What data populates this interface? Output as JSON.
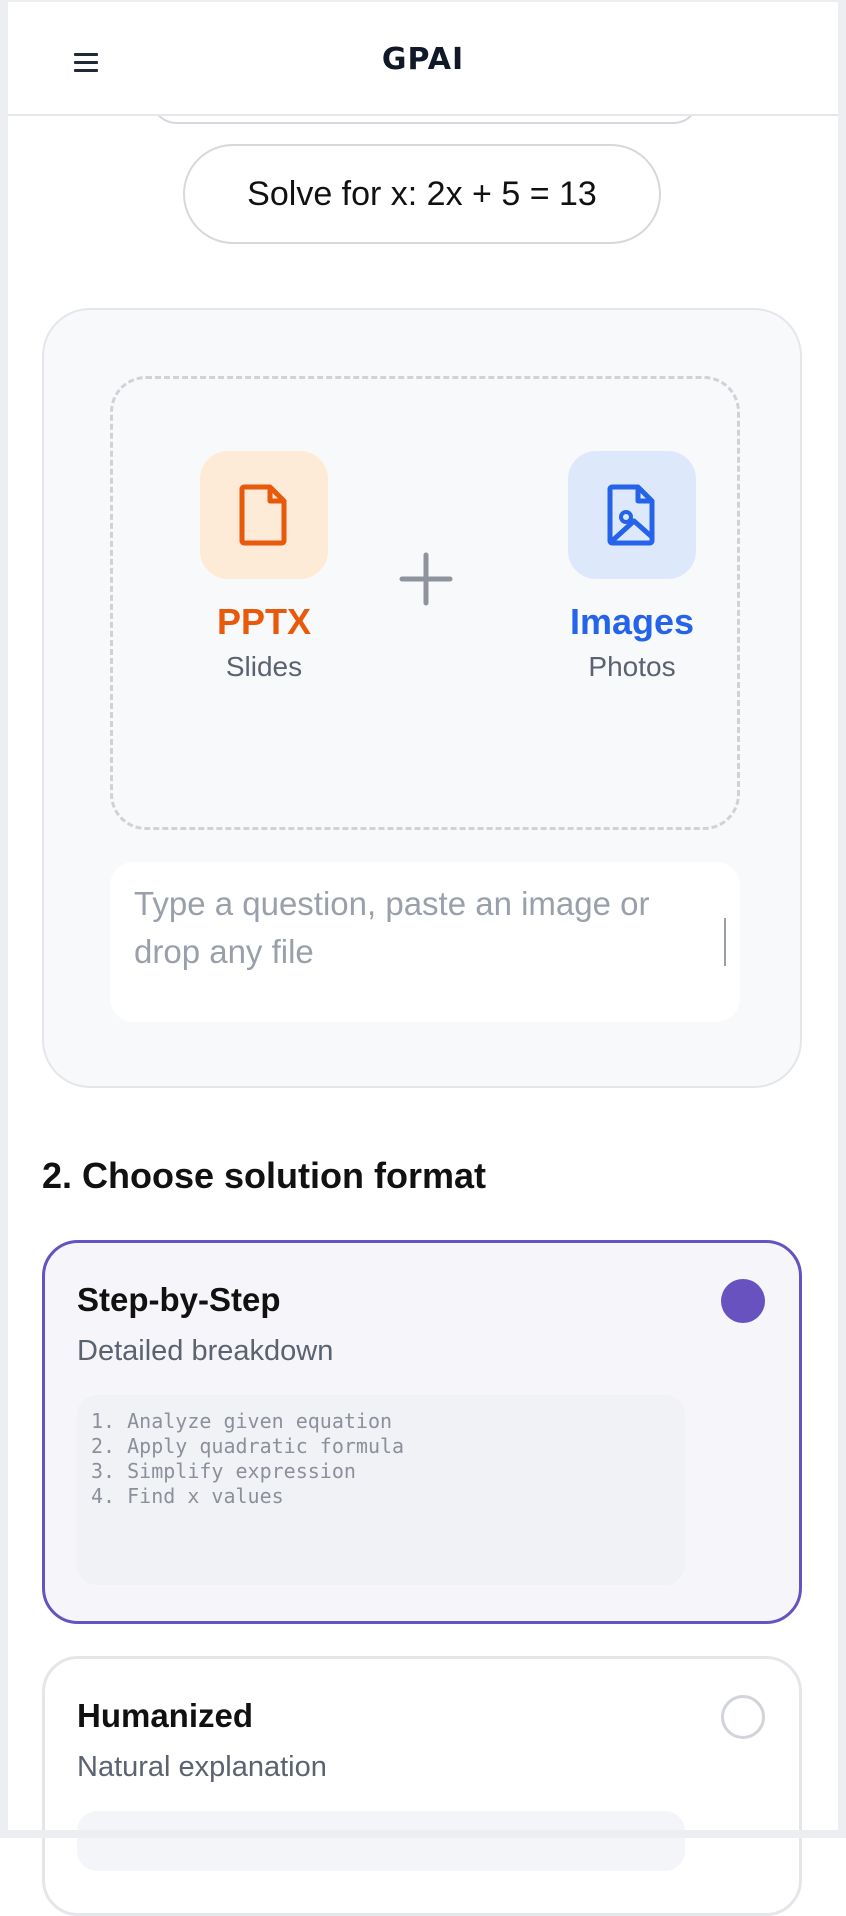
{
  "header": {
    "logo_text": "GPAI",
    "menu_icon": "hamburger-menu-icon"
  },
  "example_prompt": "Solve for x: 2x + 5 = 13",
  "upload": {
    "file_types": [
      {
        "name": "PPTX",
        "subtitle": "Slides",
        "icon": "file-icon",
        "color": "#e8590c",
        "bg": "#fdebd7"
      },
      {
        "name": "Images",
        "subtitle": "Photos",
        "icon": "image-file-icon",
        "color": "#2563eb",
        "bg": "#dde9fb"
      }
    ],
    "question_placeholder": "Type a question, paste an image or drop any file"
  },
  "solution_format": {
    "heading": "2. Choose solution format",
    "options": [
      {
        "title": "Step-by-Step",
        "subtitle": "Detailed breakdown",
        "selected": true,
        "preview": [
          "1. Analyze given equation",
          "2. Apply quadratic formula",
          "3. Simplify expression",
          "4. Find x values"
        ]
      },
      {
        "title": "Humanized",
        "subtitle": "Natural explanation",
        "selected": false
      }
    ]
  },
  "colors": {
    "accent": "#6852c0",
    "pptx": "#e8590c",
    "images": "#2563eb"
  }
}
